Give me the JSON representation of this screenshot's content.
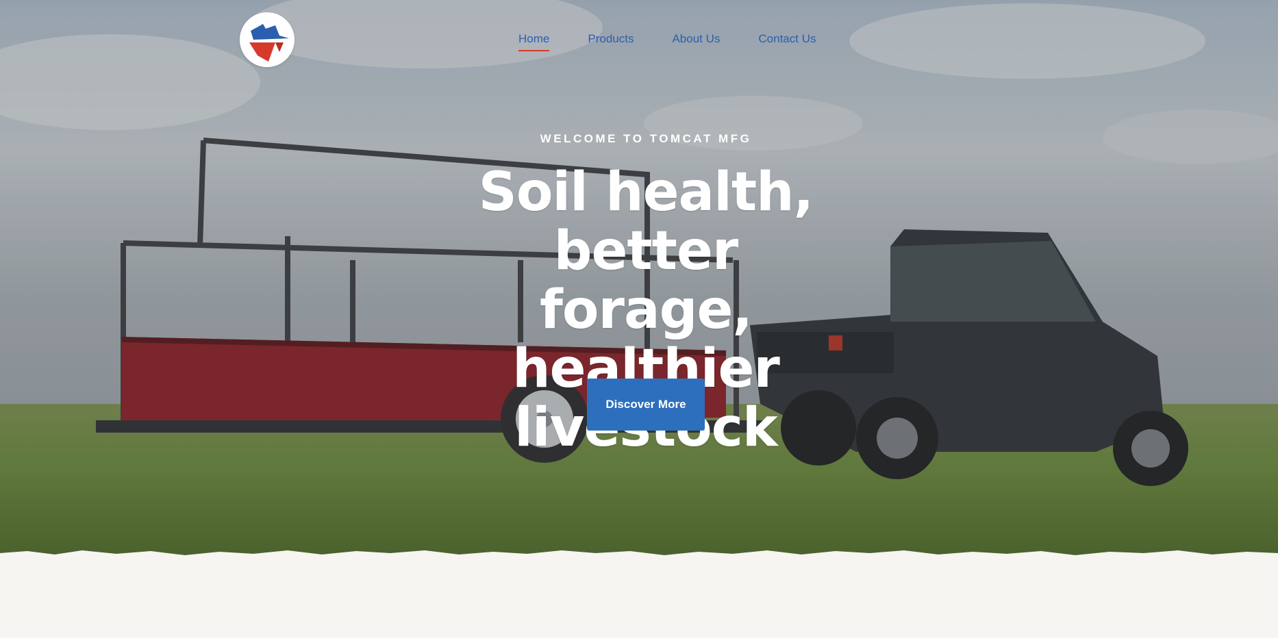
{
  "brand": {
    "logo_icon": "tomcat-hat-logo",
    "colors": {
      "blue": "#2b5fae",
      "red": "#d63a2b"
    }
  },
  "nav": {
    "items": [
      {
        "label": "Home",
        "active": true
      },
      {
        "label": "Products",
        "active": false
      },
      {
        "label": "About Us",
        "active": false
      },
      {
        "label": "Contact Us",
        "active": false
      }
    ]
  },
  "hero": {
    "eyebrow": "WELCOME TO TOMCAT MFG",
    "headline_lines": [
      "Soil health, better",
      "forage, healthier",
      "livestock"
    ],
    "cta_label": "Discover More",
    "cta_color": "#2e6fbd"
  }
}
